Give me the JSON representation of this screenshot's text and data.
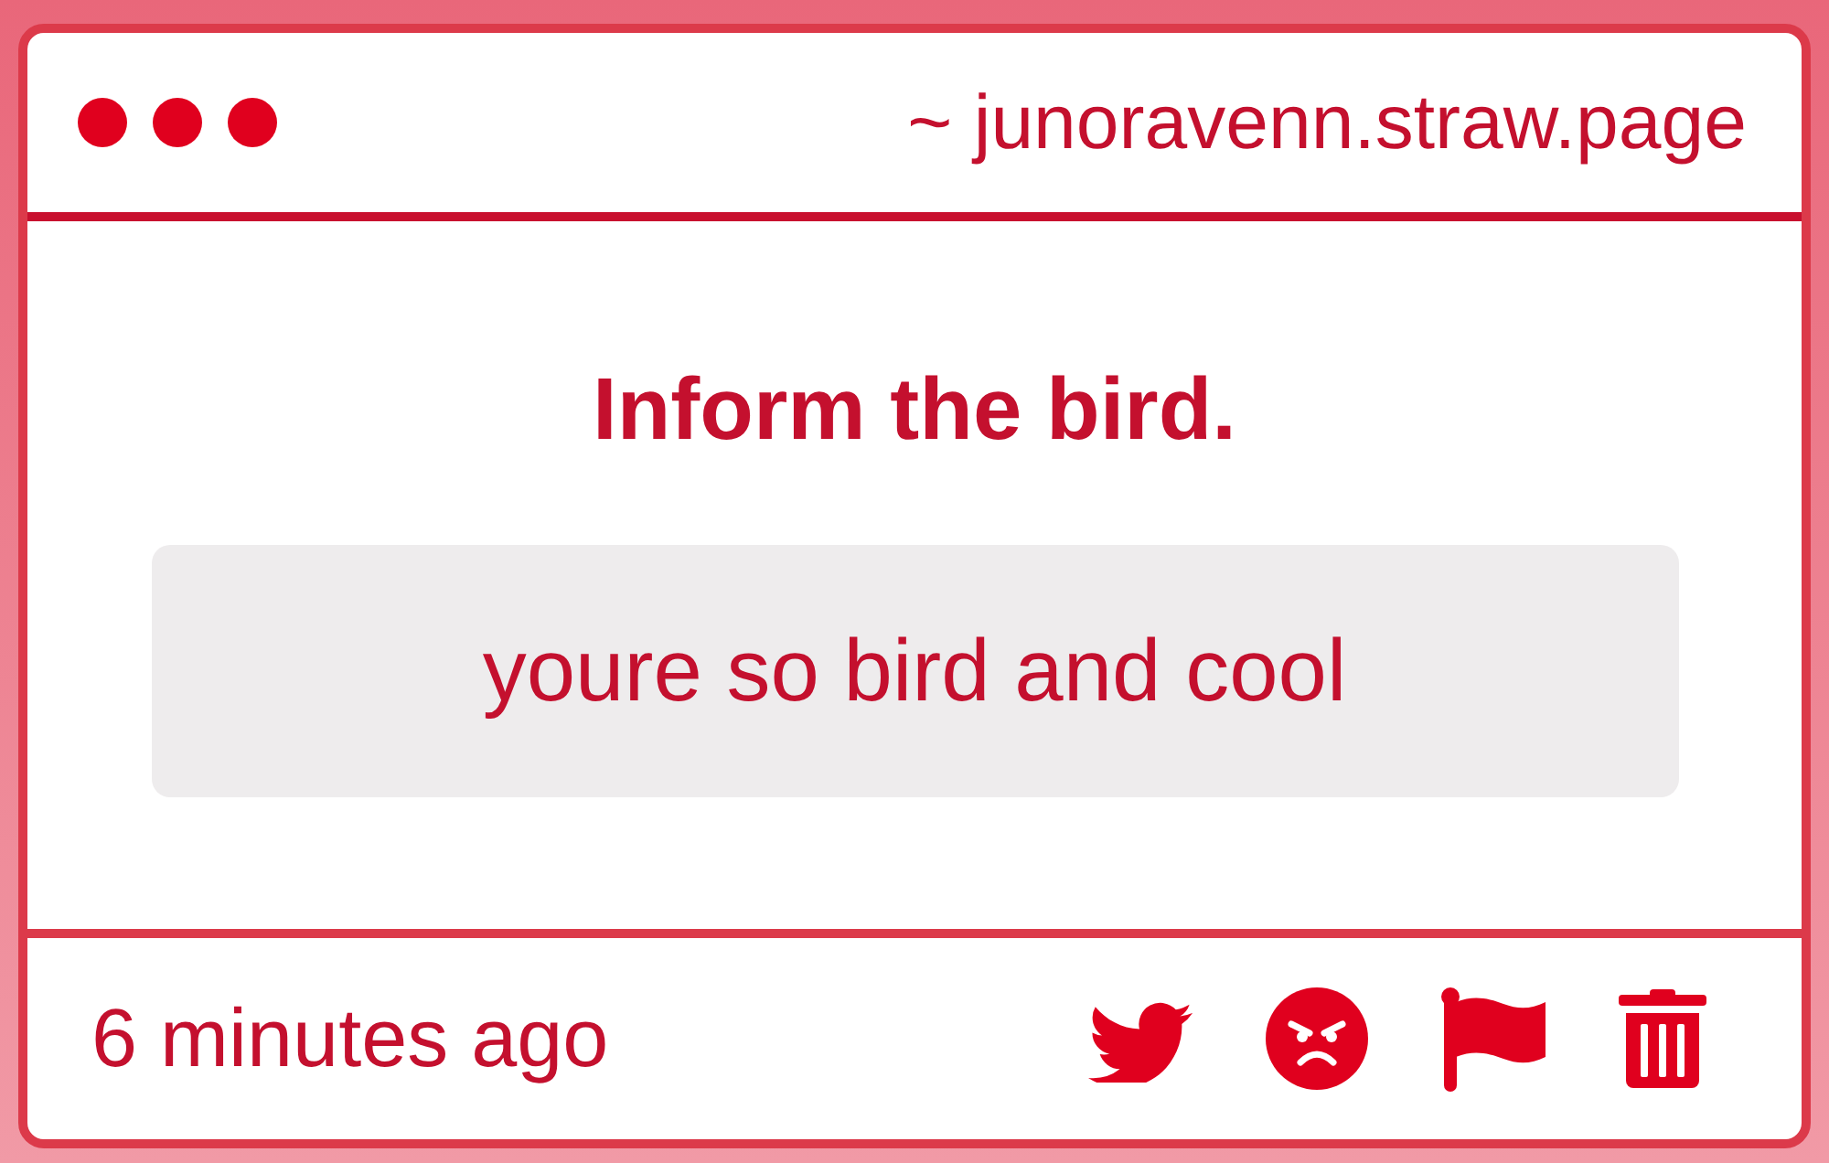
{
  "window": {
    "controls": [
      {
        "kind": "dot"
      },
      {
        "kind": "dot"
      },
      {
        "kind": "dot"
      }
    ],
    "address": "~ junoravenn.straw.page"
  },
  "question": "Inform the bird.",
  "answer": "youre so bird and cool",
  "footer": {
    "time": "6 minutes ago",
    "actions": [
      {
        "kind": "bird"
      },
      {
        "kind": "angry"
      },
      {
        "kind": "flag"
      },
      {
        "kind": "trash"
      }
    ]
  }
}
